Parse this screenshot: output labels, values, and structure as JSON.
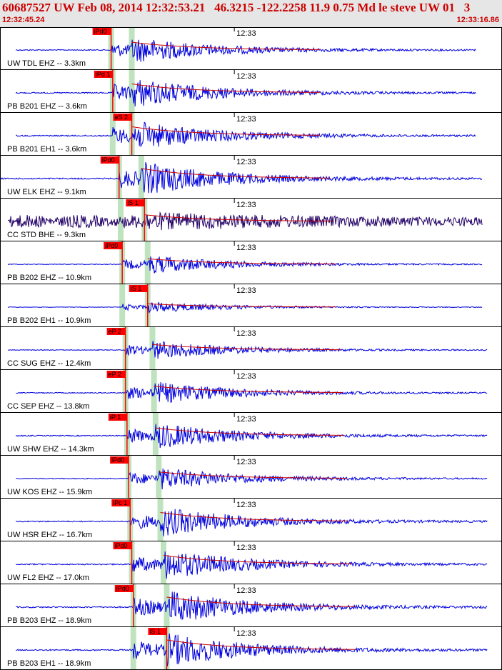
{
  "header": {
    "title": "60687527 UW Feb 08, 2014 12:32:53.21   46.3215 -122.2258 11.9 0.75 Md le steve UW 01   3",
    "start_time": "12:32:45.24",
    "end_time": "12:33:16.86"
  },
  "chart_data": {
    "type": "line",
    "title": "60687527 UW Feb 08, 2014 12:32:53.21   46.3215 -122.2258 11.9 0.75 Md le steve UW 01   3",
    "x_axis": {
      "start": "12:32:45.24",
      "end": "12:33:16.86",
      "tick_label": "12:33"
    },
    "colors": {
      "trace": "#0000dd",
      "broadband_trace": "#220066",
      "pick": "#ff0000",
      "pick_window": "#bfe3bf",
      "coda": "#cc0000"
    },
    "series": [
      {
        "name": "UW TDL EHZ -- 3.3km",
        "pick": "iPd0",
        "p_time": 7.0,
        "s_time": 8.3,
        "amp_level": 0.7,
        "extent": [
          1.0,
          30.0
        ]
      },
      {
        "name": "PB B201 EHZ -- 3.6km",
        "pick": "iPd 1",
        "p_time": 7.1,
        "s_time": 8.3,
        "amp_level": 0.8,
        "extent": [
          1.0,
          30.0
        ]
      },
      {
        "name": "PB B201 EH1 -- 3.6km",
        "pick": "eS 2",
        "p_time": 7.1,
        "s_time": 8.3,
        "amp_level": 0.8,
        "extent": [
          1.0,
          30.0
        ]
      },
      {
        "name": "UW ELK EHZ -- 9.1km",
        "pick": "iPd0",
        "p_time": 7.5,
        "s_time": 8.9,
        "amp_level": 0.9,
        "extent": [
          0.0,
          30.4
        ]
      },
      {
        "name": "CC STD BHE -- 9.3km",
        "pick": "iS 1",
        "p_time": 7.6,
        "s_time": 9.1,
        "amp_level": 0.6,
        "extent": [
          0.5,
          30.4
        ]
      },
      {
        "name": "PB B202 EHZ -- 10.9km",
        "pick": "iPd0",
        "p_time": 7.7,
        "s_time": 9.3,
        "amp_level": 0.5,
        "extent": [
          0.5,
          30.4
        ]
      },
      {
        "name": "PB B202 EH1 -- 10.9km",
        "pick": "iS 1",
        "p_time": 7.7,
        "s_time": 9.3,
        "amp_level": 0.3,
        "extent": [
          0.5,
          30.4
        ]
      },
      {
        "name": "CC SUG EHZ -- 12.4km",
        "pick": "eP 2",
        "p_time": 7.9,
        "s_time": 9.6,
        "amp_level": 0.5,
        "extent": [
          0.5,
          30.7
        ]
      },
      {
        "name": "CC SEP EHZ -- 13.8km",
        "pick": "eP 2",
        "p_time": 7.9,
        "s_time": 9.7,
        "amp_level": 0.6,
        "extent": [
          1.0,
          30.7
        ]
      },
      {
        "name": "UW SHW EHZ -- 14.3km",
        "pick": "iP 1",
        "p_time": 8.0,
        "s_time": 9.8,
        "amp_level": 0.7,
        "extent": [
          1.0,
          30.7
        ]
      },
      {
        "name": "UW KOS EHZ -- 15.9km",
        "pick": "iPd0",
        "p_time": 8.1,
        "s_time": 10.0,
        "amp_level": 0.6,
        "extent": [
          1.0,
          30.7
        ]
      },
      {
        "name": "UW HSR EHZ -- 16.7km",
        "pick": "iPc 1",
        "p_time": 8.2,
        "s_time": 10.1,
        "amp_level": 0.8,
        "extent": [
          1.0,
          30.7
        ]
      },
      {
        "name": "UW FL2 EHZ -- 17.0km",
        "pick": "iPd0",
        "p_time": 8.3,
        "s_time": 10.3,
        "amp_level": 0.8,
        "extent": [
          1.0,
          30.7
        ]
      },
      {
        "name": "PB B203 EHZ -- 18.9km",
        "pick": "iPd0",
        "p_time": 8.4,
        "s_time": 10.5,
        "amp_level": 0.9,
        "extent": [
          1.0,
          30.7
        ]
      },
      {
        "name": "PB B203 EH1 -- 18.9km",
        "pick": "iS 1",
        "p_time": 8.4,
        "s_time": 10.5,
        "amp_level": 0.9,
        "extent": [
          1.0,
          30.7
        ]
      }
    ]
  }
}
